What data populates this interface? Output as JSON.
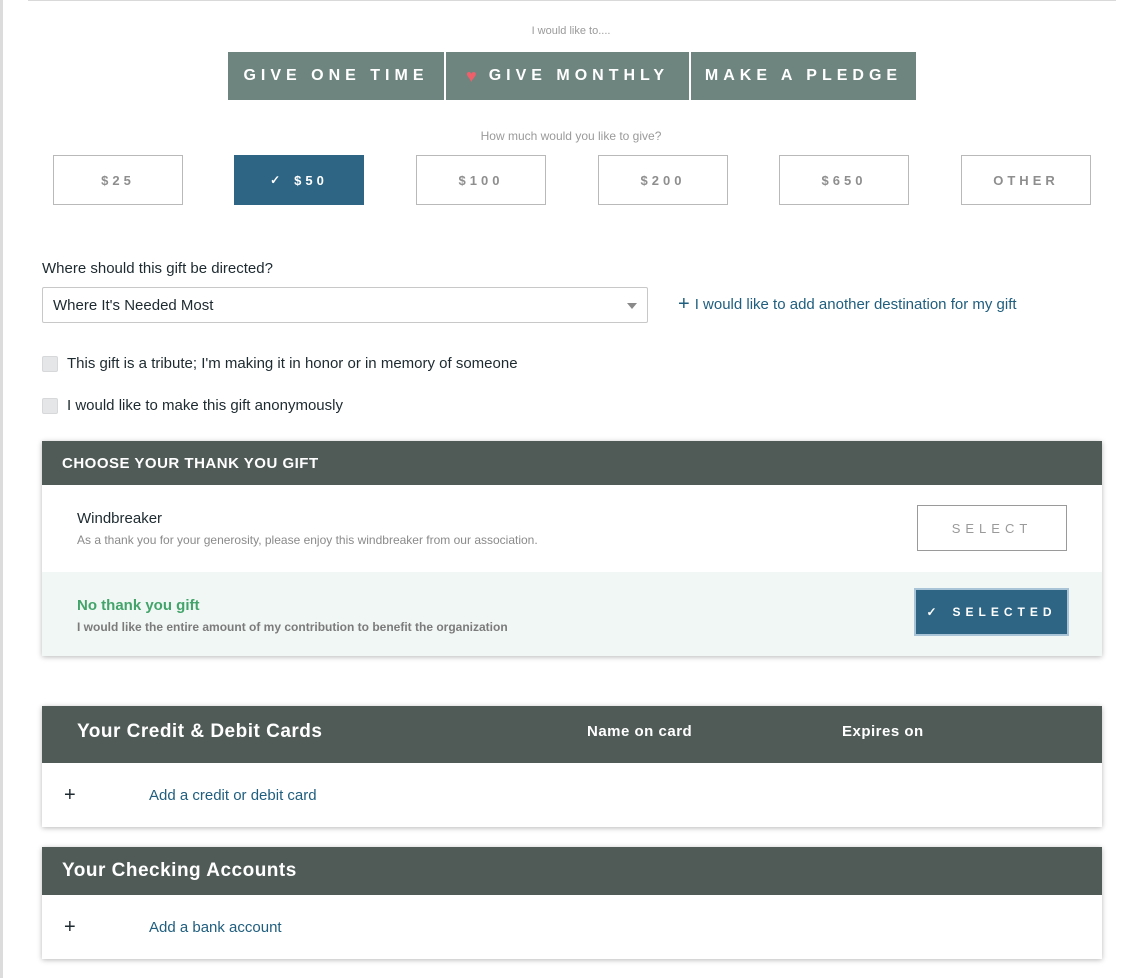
{
  "donation_type": {
    "prompt": "I would like to....",
    "options": [
      {
        "label": "GIVE ONE TIME"
      },
      {
        "label": "GIVE MONTHLY",
        "icon": "heart-icon"
      },
      {
        "label": "MAKE A PLEDGE"
      }
    ]
  },
  "amount": {
    "prompt": "How much would you like to give?",
    "options": [
      "$25",
      "$50",
      "$100",
      "$200",
      "$650",
      "OTHER"
    ],
    "selected": "$50"
  },
  "direction": {
    "label": "Where should this gift be directed?",
    "selected_value": "Where It's Needed Most",
    "add_destination_link": "I would like to add another destination for my gift"
  },
  "options": {
    "tribute": "This gift is a tribute; I'm making it in honor or in memory of someone",
    "anonymous": "I would like to make this gift anonymously"
  },
  "thank_you_gift": {
    "header": "CHOOSE YOUR THANK YOU GIFT",
    "items": [
      {
        "title": "Windbreaker",
        "description": "As a thank you for your generosity, please enjoy this windbreaker from our association.",
        "button": "SELECT"
      },
      {
        "title": "No thank you gift",
        "description": "I would like the entire amount of my contribution to benefit the organization",
        "button": "SELECTED"
      }
    ]
  },
  "cards": {
    "header": "Your Credit & Debit Cards",
    "col_name": "Name on card",
    "col_expires": "Expires on",
    "add_link": "Add a credit or debit card"
  },
  "checking": {
    "header": "Your Checking Accounts",
    "add_link": "Add a bank account"
  },
  "colors": {
    "primary_blue": "#2e6584",
    "type_button_gray": "#6e847f",
    "panel_header": "#505b58",
    "success_green": "#43a46b",
    "heart_pink": "#ef5f6a"
  }
}
